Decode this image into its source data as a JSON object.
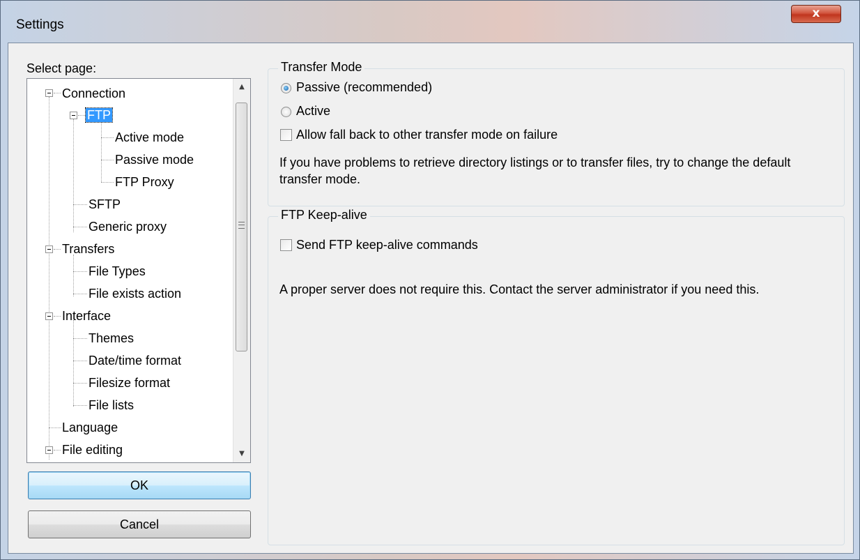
{
  "window": {
    "title": "Settings",
    "close_label": "x"
  },
  "sidebar": {
    "select_page_label": "Select page:",
    "tree": {
      "connection": "Connection",
      "ftp": "FTP",
      "active_mode": "Active mode",
      "passive_mode": "Passive mode",
      "ftp_proxy": "FTP Proxy",
      "sftp": "SFTP",
      "generic_proxy": "Generic proxy",
      "transfers": "Transfers",
      "file_types": "File Types",
      "file_exists_action": "File exists action",
      "interface": "Interface",
      "themes": "Themes",
      "datetime_format": "Date/time format",
      "filesize_format": "Filesize format",
      "file_lists": "File lists",
      "language": "Language",
      "file_editing": "File editing"
    },
    "selected": "FTP"
  },
  "buttons": {
    "ok": "OK",
    "cancel": "Cancel"
  },
  "transfer_mode": {
    "title": "Transfer Mode",
    "passive_label": "Passive (recommended)",
    "active_label": "Active",
    "selected": "passive",
    "fallback_label": "Allow fall back to other transfer mode on failure",
    "fallback_checked": false,
    "help_text": "If you have problems to retrieve directory listings or to transfer files, try to change the default transfer mode."
  },
  "keepalive": {
    "title": "FTP Keep-alive",
    "send_label": "Send FTP keep-alive commands",
    "send_checked": false,
    "help_text": "A proper server does not require this. Contact the server administrator if you need this."
  },
  "icons": {
    "close": "close-icon",
    "scroll_up": "scroll-up-arrow-icon",
    "scroll_down": "scroll-down-arrow-icon",
    "expander": "tree-collapse-icon"
  }
}
